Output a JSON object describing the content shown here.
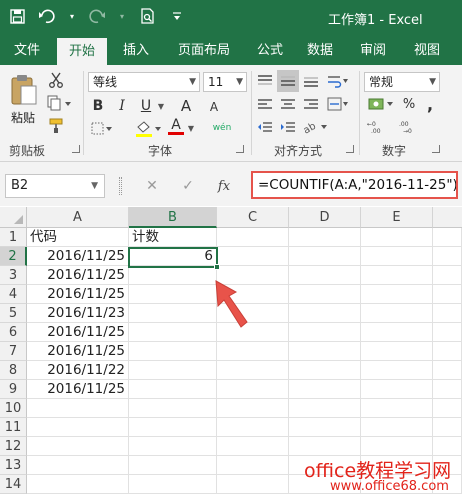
{
  "window": {
    "title": "工作簿1 - Excel"
  },
  "quick_access": {
    "icons": [
      "save-icon",
      "undo-icon",
      "redo-icon",
      "print-preview-icon",
      "customize-icon"
    ]
  },
  "tabs": [
    {
      "label": "文件"
    },
    {
      "label": "开始",
      "active": true
    },
    {
      "label": "插入"
    },
    {
      "label": "页面布局"
    },
    {
      "label": "公式"
    },
    {
      "label": "数据"
    },
    {
      "label": "审阅"
    },
    {
      "label": "视图"
    }
  ],
  "ribbon": {
    "clipboard": {
      "paste_label": "粘贴",
      "group_label": "剪贴板"
    },
    "font": {
      "font_name": "等线",
      "font_size": "11",
      "bold": "B",
      "italic": "I",
      "underline": "U",
      "grow": "A",
      "shrink": "A",
      "font_color_letter": "A",
      "phonetic": "wén",
      "group_label": "字体"
    },
    "alignment": {
      "group_label": "对齐方式"
    },
    "number": {
      "format": "常规",
      "group_label": "数字"
    }
  },
  "formula_bar": {
    "name_box": "B2",
    "cancel": "✕",
    "enter": "✓",
    "fx": "fx",
    "formula": "=COUNTIF(A:A,\"2016-11-25\")"
  },
  "sheet": {
    "columns": [
      "A",
      "B",
      "C",
      "D",
      "E"
    ],
    "selected_column": "B",
    "rows": [
      "1",
      "2",
      "3",
      "4",
      "5",
      "6",
      "7",
      "8",
      "9",
      "10",
      "11",
      "12",
      "13",
      "14"
    ],
    "selected_row": "2",
    "cells": {
      "A1": "代码",
      "B1": "计数",
      "A2": "2016/11/25",
      "B2": "6",
      "A3": "2016/11/25",
      "A4": "2016/11/25",
      "A5": "2016/11/23",
      "A6": "2016/11/25",
      "A7": "2016/11/25",
      "A8": "2016/11/22",
      "A9": "2016/11/25"
    },
    "active_cell": "B2"
  },
  "watermark": {
    "line1": "office教程学习网",
    "line2": "www.office68.com"
  },
  "colors": {
    "excel_green": "#217346",
    "highlight_red": "#e5534b",
    "arrow_red": "#e8534a"
  }
}
